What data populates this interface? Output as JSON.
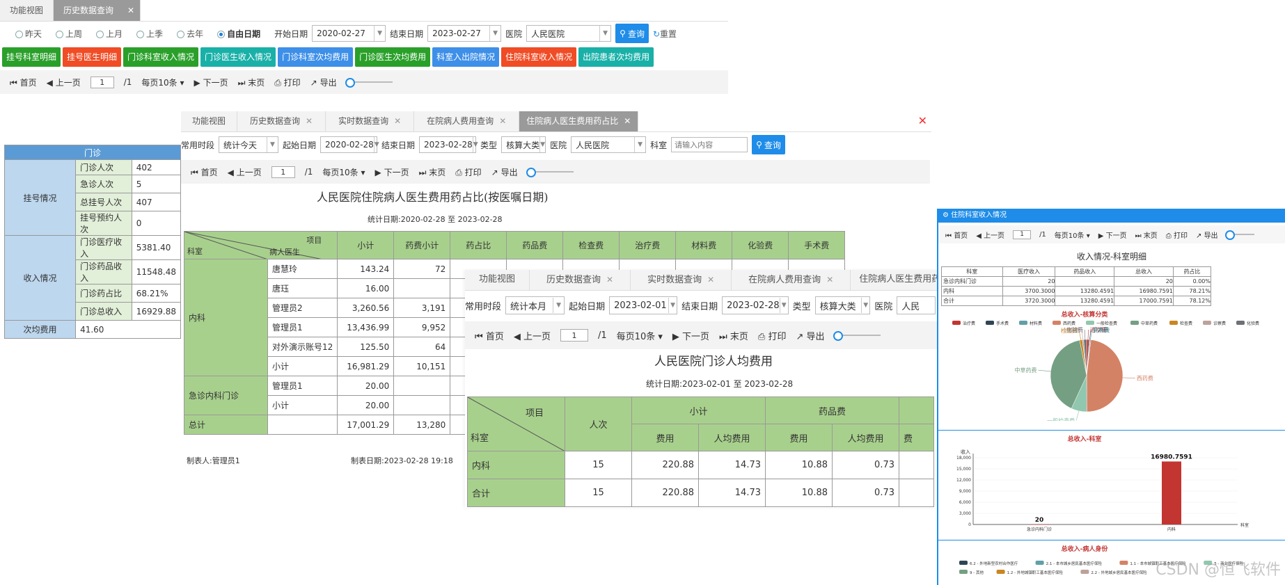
{
  "p1": {
    "tabs": [
      "功能视图",
      "历史数据查询"
    ],
    "radios": [
      "昨天",
      "上周",
      "上月",
      "上季",
      "去年",
      "自由日期"
    ],
    "start_label": "开始日期",
    "start_val": "2020-02-27",
    "end_label": "结束日期",
    "end_val": "2023-02-27",
    "hosp_label": "医院",
    "hosp_val": "人民医院",
    "query": "查询",
    "reset": "重置",
    "buttons": [
      "挂号科室明细",
      "挂号医生明细",
      "门诊科室收入情况",
      "门诊医生收入情况",
      "门诊科室次均费用",
      "门诊医生次均费用",
      "科室入出院情况",
      "住院科室收入情况",
      "出院患者次均费用"
    ],
    "pager": {
      "first": "首页",
      "prev": "上一页",
      "page": "1",
      "of": "/1",
      "per": "每页10条",
      "next": "下一页",
      "last": "末页",
      "print": "打印",
      "export": "导出"
    },
    "table": {
      "header": "门诊",
      "groups": [
        {
          "name": "挂号情况",
          "rows": [
            [
              "门诊人次",
              "402"
            ],
            [
              "急诊人次",
              "5"
            ],
            [
              "总挂号人次",
              "407"
            ],
            [
              "挂号预约人次",
              "0"
            ]
          ]
        },
        {
          "name": "收入情况",
          "rows": [
            [
              "门诊医疗收入",
              "5381.40"
            ],
            [
              "门诊药品收入",
              "11548.48"
            ],
            [
              "门诊药占比",
              "68.21%"
            ],
            [
              "门诊总收入",
              "16929.88"
            ]
          ]
        }
      ],
      "avg_label": "次均费用",
      "avg_val": "41.60"
    }
  },
  "p2": {
    "tabs": [
      "功能视图",
      "历史数据查询",
      "实时数据查询",
      "在院病人费用查询",
      "住院病人医生费用药占比"
    ],
    "period_label": "常用时段",
    "period_val": "统计今天",
    "start_label": "起始日期",
    "start_val": "2020-02-28",
    "end_label": "结束日期",
    "end_val": "2023-02-28",
    "type_label": "类型",
    "type_val": "核算大类",
    "hosp_label": "医院",
    "hosp_val": "人民医院",
    "dept_label": "科室",
    "dept_ph": "请输入内容",
    "query": "查询",
    "pager": {
      "first": "首页",
      "prev": "上一页",
      "page": "1",
      "of": "/1",
      "per": "每页10条",
      "next": "下一页",
      "last": "末页",
      "print": "打印",
      "export": "导出"
    },
    "title": "人民医院住院病人医生费用药占比(按医嘱日期)",
    "stat": "统计日期:2020-02-28 至 2023-02-28",
    "h_item": "项目",
    "h_dept": "科室",
    "h_doc": "病人医生",
    "cols": [
      "小计",
      "药费小计",
      "药占比",
      "药品费",
      "检查费",
      "治疗费",
      "材料费",
      "化验费",
      "手术费"
    ],
    "dept1": "内科",
    "rows1": [
      [
        "唐慧玲",
        "143.24",
        "72"
      ],
      [
        "唐珏",
        "16.00",
        ""
      ],
      [
        "管理员2",
        "3,260.56",
        "3,191"
      ],
      [
        "管理员1",
        "13,436.99",
        "9,952"
      ],
      [
        "对外演示账号12",
        "125.50",
        "64"
      ],
      [
        "小计",
        "16,981.29",
        "10,151"
      ]
    ],
    "dept2": "急诊内科门诊",
    "rows2": [
      [
        "管理员1",
        "20.00",
        ""
      ],
      [
        "小计",
        "20.00",
        ""
      ]
    ],
    "total_label": "总计",
    "total_v1": "17,001.29",
    "total_v2": "13,280",
    "maker": "制表人:管理员1",
    "date": "制表日期:2023-02-28  19:18"
  },
  "p3": {
    "tabs": [
      "功能视图",
      "历史数据查询",
      "实时数据查询",
      "在院病人费用查询",
      "住院病人医生费用药"
    ],
    "period_label": "常用时段",
    "period_val": "统计本月",
    "start_label": "起始日期",
    "start_val": "2023-02-01",
    "end_label": "结束日期",
    "end_val": "2023-02-28",
    "type_label": "类型",
    "type_val": "核算大类",
    "hosp_label": "医院",
    "hosp_val": "人民",
    "pager": {
      "first": "首页",
      "prev": "上一页",
      "page": "1",
      "of": "/1",
      "per": "每页10条",
      "next": "下一页",
      "last": "末页",
      "print": "打印",
      "export": "导出"
    },
    "title": "人民医院门诊人均费用",
    "stat": "统计日期:2023-02-01  至  2023-02-28",
    "h_item": "项目",
    "h_dept": "科室",
    "h_count": "人次",
    "h_sub": "小计",
    "h_drug": "药品费",
    "h_fee": "费用",
    "h_avg": "人均费用",
    "h_fee2": "费",
    "rows": [
      [
        "内科",
        "15",
        "220.88",
        "14.73",
        "10.88",
        "0.73"
      ],
      [
        "合计",
        "15",
        "220.88",
        "14.73",
        "10.88",
        "0.73"
      ]
    ]
  },
  "p4": {
    "title_bar": "住院科室收入情况",
    "pager": {
      "first": "首页",
      "prev": "上一页",
      "page": "1",
      "of": "/1",
      "per": "每页10条",
      "next": "下一页",
      "last": "末页",
      "print": "打印",
      "export": "导出"
    },
    "title": "收入情况-科室明细",
    "cols": [
      "科室",
      "医疗收入",
      "药品收入",
      "总收入",
      "药占比"
    ],
    "rows": [
      [
        "急诊内科门诊",
        "20",
        "",
        "20",
        "0.00%"
      ],
      [
        "内科",
        "3700.3000",
        "13280.4591",
        "16980.7591",
        "78.21%"
      ],
      [
        "合计",
        "3720.3000",
        "13280.4591",
        "17000.7591",
        "78.12%"
      ]
    ],
    "watermark": "CSDN @恒飞软件"
  },
  "chart_data": [
    {
      "type": "pie",
      "title": "总收入-核算分类",
      "legend": [
        "治疗费",
        "手术费",
        "材料费",
        "西药费",
        "一般检查费",
        "中草药费",
        "检查费",
        "诊察费",
        "化验费"
      ],
      "colors": [
        "#c23531",
        "#2f4554",
        "#61a0a8",
        "#d48265",
        "#91c7ae",
        "#749f83",
        "#ca8622",
        "#bda29a",
        "#6e7074"
      ],
      "values": [
        1.2,
        0.3,
        0.4,
        48,
        7,
        40,
        1.2,
        0.6,
        1.3
      ],
      "labels": [
        "治疗费",
        "手术费",
        "材料费",
        "西药费",
        "一般检查费",
        "中草药费",
        "检查费",
        "诊察费",
        "化验费"
      ]
    },
    {
      "type": "bar",
      "title": "总收入-科室",
      "ylabel": "收入",
      "xlabel": "科室",
      "categories": [
        "急诊内科门诊",
        "内科"
      ],
      "values": [
        20,
        16980.7591
      ],
      "data_labels": [
        "20",
        "16980.7591"
      ],
      "yticks": [
        "0",
        "3,000",
        "6,000",
        "9,000",
        "12,000",
        "15,000",
        "18,000"
      ],
      "ylim": [
        0,
        18000
      ],
      "color": "#c23531"
    },
    {
      "type": "pie",
      "title": "总收入-病人身份",
      "legend": [
        "6.2 - 外地新型农村合作医疗",
        "2.1 - 本市城乡居民基本医疗保险",
        "1.1 - 本市城镇职工基本医疗保险",
        "5 - 商业医疗保险",
        "9 - 其他",
        "1.2 - 外地城镇职工基本医疗保险",
        "2.2 - 外地城乡居民基本医疗保险"
      ],
      "colors": [
        "#2f4554",
        "#61a0a8",
        "#d48265",
        "#91c7ae",
        "#749f83",
        "#ca8622",
        "#bda29a"
      ]
    }
  ]
}
